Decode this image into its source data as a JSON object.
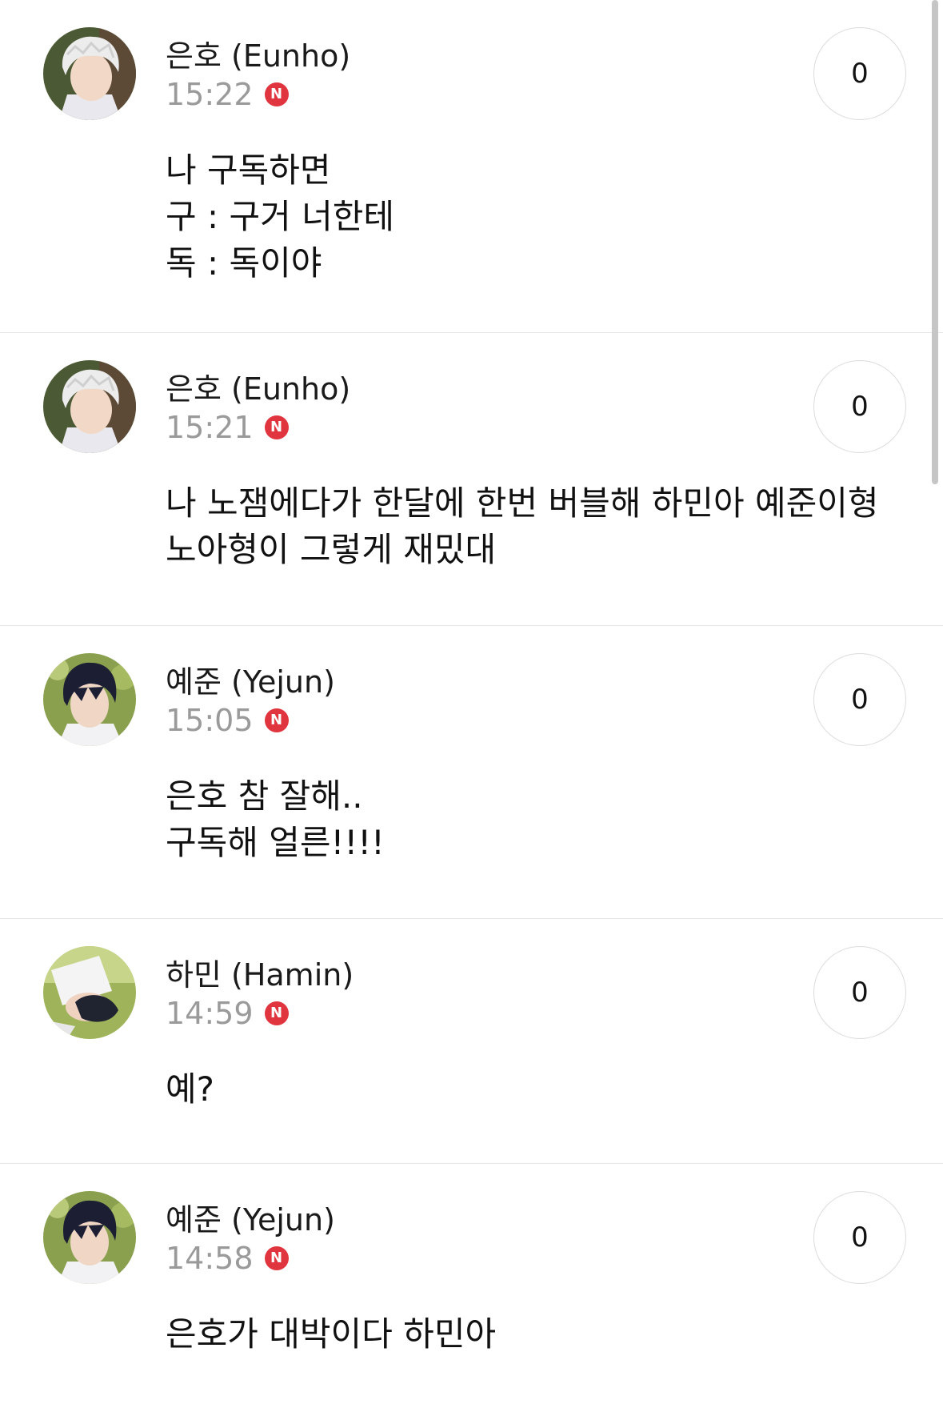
{
  "posts": [
    {
      "author": "은호 (Eunho)",
      "time": "15:22",
      "badge": "N",
      "likes": "0",
      "avatar": "eunho",
      "lines": [
        "나 구독하면",
        "구 : 구거 너한테",
        "독 : 독이야"
      ]
    },
    {
      "author": "은호 (Eunho)",
      "time": "15:21",
      "badge": "N",
      "likes": "0",
      "avatar": "eunho",
      "lines": [
        "나 노잼에다가 한달에 한번 버블해 하민아 예준이형",
        "노아형이 그렇게 재밌대"
      ]
    },
    {
      "author": "예준 (Yejun)",
      "time": "15:05",
      "badge": "N",
      "likes": "0",
      "avatar": "yejun",
      "lines": [
        "은호 참 잘해..",
        "구독해 얼른!!!!"
      ]
    },
    {
      "author": "하민 (Hamin)",
      "time": "14:59",
      "badge": "N",
      "likes": "0",
      "avatar": "hamin",
      "lines": [
        "예?"
      ]
    },
    {
      "author": "예준 (Yejun)",
      "time": "14:58",
      "badge": "N",
      "likes": "0",
      "avatar": "yejun",
      "lines": [
        "은호가 대박이다 하민아"
      ]
    }
  ],
  "colors": {
    "badge": "#e0353e",
    "time": "#9a9a9a",
    "divider": "#e6e6e6"
  }
}
